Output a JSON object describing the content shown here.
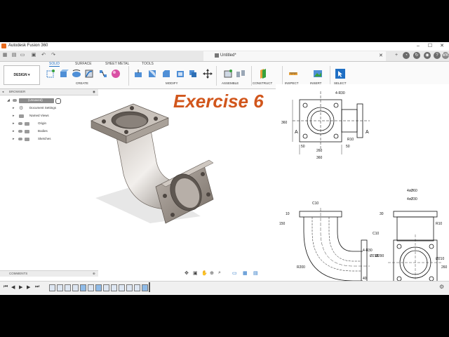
{
  "window": {
    "title": "Autodesk Fusion 360"
  },
  "document_tab": {
    "label": "Untitled*"
  },
  "user": {
    "initials": "MK"
  },
  "ribbon": {
    "workspace": "DESIGN",
    "tabs": [
      "SOLID",
      "SURFACE",
      "SHEET METAL",
      "TOOLS"
    ],
    "groups": [
      "CREATE",
      "MODIFY",
      "ASSEMBLE",
      "CONSTRUCT",
      "INSPECT",
      "INSERT",
      "SELECT"
    ]
  },
  "browser": {
    "title": "BROWSER",
    "items": [
      "(Unsaved)",
      "Document Settings",
      "Named Views",
      "Origin",
      "Bodies",
      "Sketches"
    ]
  },
  "comments": {
    "title": "COMMENTS"
  },
  "overlay": {
    "exercise_title": "Exercise 6"
  },
  "drawing": {
    "top": {
      "dims": [
        "4-R30",
        "360",
        "260",
        "50",
        "50",
        "360",
        "R10"
      ],
      "section": [
        "A",
        "A"
      ]
    },
    "front": {
      "dims": [
        "C10",
        "10",
        "150",
        "C10",
        "4-R30",
        "R200",
        "Ø210",
        "Ø290",
        "40",
        "260",
        "150"
      ]
    },
    "side": {
      "dims": [
        "4xØ60",
        "4xØ30",
        "30",
        "R10",
        "Ø210",
        "260",
        "260",
        "360"
      ]
    }
  },
  "colors": {
    "accent": "#1f6fc4",
    "exercise": "#d1561c",
    "model": "#a49b93"
  }
}
